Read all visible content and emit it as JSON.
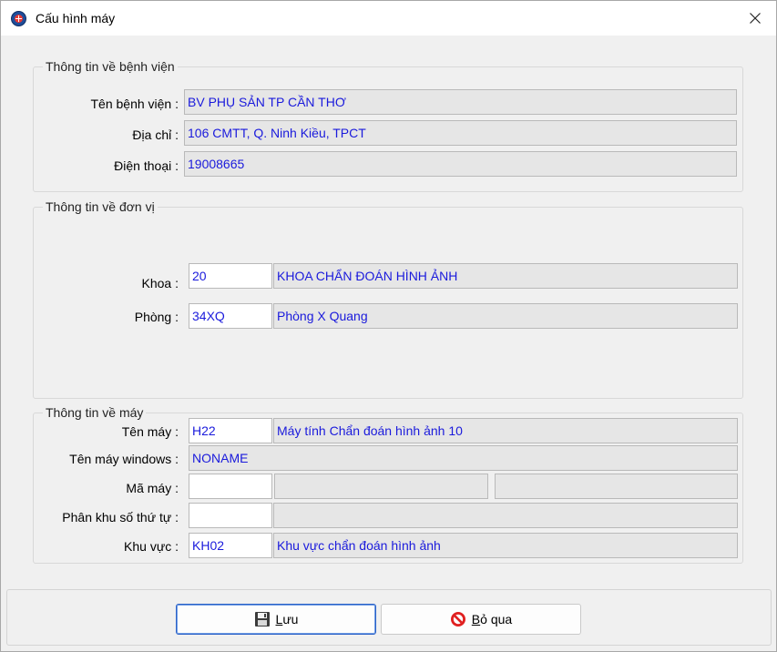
{
  "window": {
    "title": "Cấu hình máy"
  },
  "hospital": {
    "legend": "Thông tin về bệnh viện",
    "name_label": "Tên bệnh viện :",
    "name_value": "BV PHỤ SẢN TP CẦN THƠ",
    "address_label": "Địa chỉ :",
    "address_value": "106 CMTT, Q. Ninh Kiều, TPCT",
    "phone_label": "Điện thoại :",
    "phone_value": "19008665"
  },
  "unit": {
    "legend": "Thông tin về đơn vị",
    "dept_label": "Khoa :",
    "dept_code": "20",
    "dept_name": "KHOA CHẨN ĐOÁN HÌNH ẢNH",
    "room_label": "Phòng :",
    "room_code": "34XQ",
    "room_name": "Phòng X Quang"
  },
  "machine": {
    "legend": "Thông tin về máy",
    "name_label": "Tên máy :",
    "name_code": "H22",
    "name_value": "Máy tính Chẩn đoán hình ảnh 10",
    "windows_label": "Tên máy windows :",
    "windows_value": "NONAME",
    "id_label": "Mã máy :",
    "id_value": "",
    "id_extra1": "",
    "id_extra2": "",
    "seq_label": "Phân khu số thứ tự :",
    "seq_code": "",
    "seq_value": "",
    "area_label": "Khu vực :",
    "area_code": "KH02",
    "area_name": "Khu vực chẩn đoán hình ảnh"
  },
  "buttons": {
    "save_hotkey": "L",
    "save_rest": "ưu",
    "cancel_hotkey": "B",
    "cancel_rest": "ỏ qua"
  },
  "icons": {
    "app": "hospital-cross-icon",
    "close": "close-icon",
    "save": "floppy-disk-icon",
    "cancel": "no-entry-icon"
  },
  "colors": {
    "value_text": "#1a1adc",
    "readonly_bg": "#e6e6e6",
    "default_button_border": "#2b62c8"
  }
}
